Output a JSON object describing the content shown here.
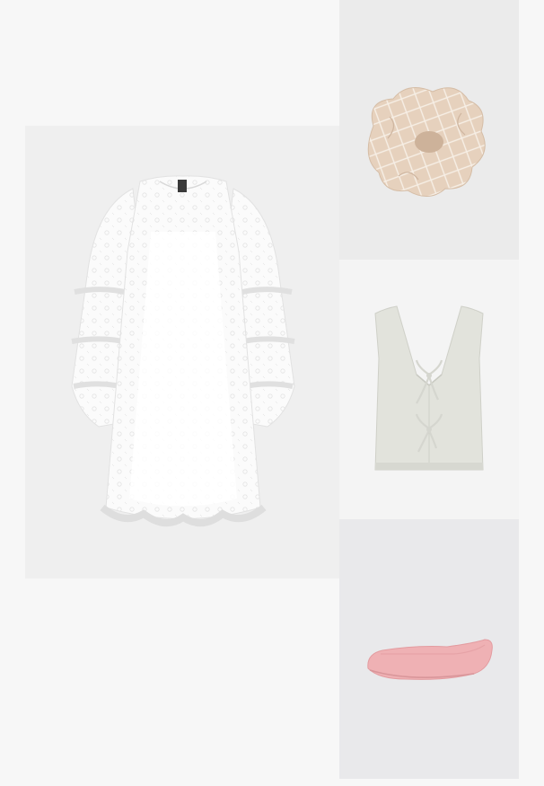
{
  "outfit": {
    "items": [
      {
        "name": "dress",
        "kind": "lace-mini-dress",
        "color": "#fbfbfb"
      },
      {
        "name": "scrunchie",
        "kind": "checked-scrunchie",
        "color": "#e8d4c2"
      },
      {
        "name": "vest",
        "kind": "knit-tie-front-vest",
        "color": "#e3e4dd"
      },
      {
        "name": "shoe",
        "kind": "ballet-flat",
        "color": "#efb1b4"
      }
    ],
    "background_color": "#f7f7f7"
  }
}
